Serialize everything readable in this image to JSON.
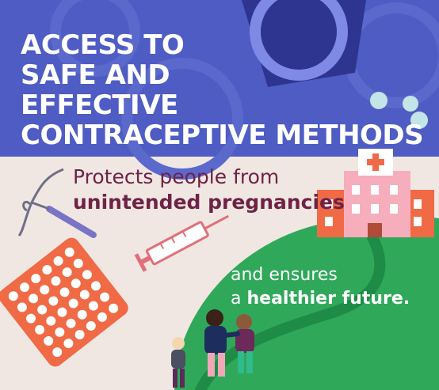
{
  "headline": {
    "line1": "ACCESS TO",
    "line2": "SAFE AND",
    "line3": "EFFECTIVE",
    "line4": "CONTRACEPTIVE METHODS"
  },
  "protects": {
    "line1": "Protects people from",
    "line2": "unintended pregnancies"
  },
  "ensures": {
    "line1": "and ensures",
    "line2_prefix": "a",
    "line2_bold": "healthier future."
  },
  "colors": {
    "top_background": "#4e5cc4",
    "bottom_background": "#f1e7e2",
    "hill": "#2fa85a",
    "text_maroon": "#6e2346",
    "accent_orange": "#f06a45",
    "hospital_pink": "#f6aebc"
  },
  "icons": [
    "condom-package-icon",
    "pill-dots-icon",
    "iud-icon",
    "syringe-icon",
    "pill-pack-icon",
    "hospital-icon",
    "family-icon"
  ]
}
